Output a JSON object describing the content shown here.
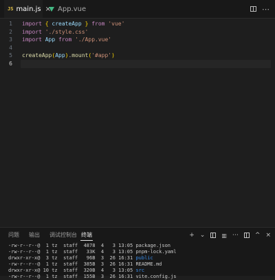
{
  "tabs": [
    {
      "badge": "JS",
      "label": "main.js",
      "close": "×",
      "active": true
    },
    {
      "label": "App.vue",
      "active": false
    }
  ],
  "toolbar_icons": [
    "split-editor-icon",
    "more-icon"
  ],
  "editor": {
    "current_line": 6,
    "lines": [
      {
        "n": "1",
        "tokens": [
          [
            "kw",
            "import"
          ],
          [
            "pt",
            " "
          ],
          [
            "br",
            "{"
          ],
          [
            "pt",
            " "
          ],
          [
            "id",
            "createApp"
          ],
          [
            "pt",
            " "
          ],
          [
            "br",
            "}"
          ],
          [
            "pt",
            " "
          ],
          [
            "kw",
            "from"
          ],
          [
            "pt",
            " "
          ],
          [
            "str",
            "'vue'"
          ]
        ]
      },
      {
        "n": "2",
        "tokens": [
          [
            "kw",
            "import"
          ],
          [
            "pt",
            " "
          ],
          [
            "str",
            "'./style.css'"
          ]
        ]
      },
      {
        "n": "3",
        "tokens": [
          [
            "kw",
            "import"
          ],
          [
            "pt",
            " "
          ],
          [
            "id",
            "App"
          ],
          [
            "pt",
            " "
          ],
          [
            "kw",
            "from"
          ],
          [
            "pt",
            " "
          ],
          [
            "str",
            "'./App.vue'"
          ]
        ]
      },
      {
        "n": "4",
        "tokens": []
      },
      {
        "n": "5",
        "tokens": [
          [
            "fn",
            "createApp"
          ],
          [
            "br",
            "("
          ],
          [
            "id",
            "App"
          ],
          [
            "br",
            ")"
          ],
          [
            "pt",
            "."
          ],
          [
            "fn",
            "mount"
          ],
          [
            "br",
            "("
          ],
          [
            "str",
            "'#app'"
          ],
          [
            "br",
            ")"
          ]
        ]
      },
      {
        "n": "6",
        "tokens": []
      }
    ]
  },
  "panel": {
    "tabs": [
      "问题",
      "输出",
      "调试控制台",
      "终端"
    ],
    "active_tab": "终端",
    "icons": {
      "add": "+",
      "dropdown": "⌄",
      "trash": "🗑",
      "more": "⋯",
      "up": "^",
      "close": "×"
    }
  },
  "terminal": {
    "rows": [
      {
        "perm": "-rw-r--r--@",
        "links": " 1",
        "user": "tz",
        "group": "staff",
        "size": " 4878",
        "month": "4",
        "day": " 3",
        "time": "13:05",
        "name": "package.json",
        "dir": false
      },
      {
        "perm": "-rw-r--r--@",
        "links": " 1",
        "user": "tz",
        "group": "staff",
        "size": "  33K",
        "month": "4",
        "day": " 3",
        "time": "13:05",
        "name": "pnpm-lock.yaml",
        "dir": false
      },
      {
        "perm": "drwxr-xr-x@",
        "links": " 3",
        "user": "tz",
        "group": "staff",
        "size": "  96B",
        "month": "3",
        "day": "26",
        "time": "16:31",
        "name": "public",
        "dir": true
      },
      {
        "perm": "-rw-r--r--@",
        "links": " 1",
        "user": "tz",
        "group": "staff",
        "size": " 385B",
        "month": "3",
        "day": "26",
        "time": "16:31",
        "name": "README.md",
        "dir": false
      },
      {
        "perm": "drwxr-xr-x@",
        "links": "10",
        "user": "tz",
        "group": "staff",
        "size": " 320B",
        "month": "4",
        "day": " 3",
        "time": "13:05",
        "name": "src",
        "dir": true
      },
      {
        "perm": "-rw-r--r--@",
        "links": " 1",
        "user": "tz",
        "group": "staff",
        "size": " 155B",
        "month": "3",
        "day": "26",
        "time": "16:31",
        "name": "vite.config.js",
        "dir": false
      }
    ]
  }
}
